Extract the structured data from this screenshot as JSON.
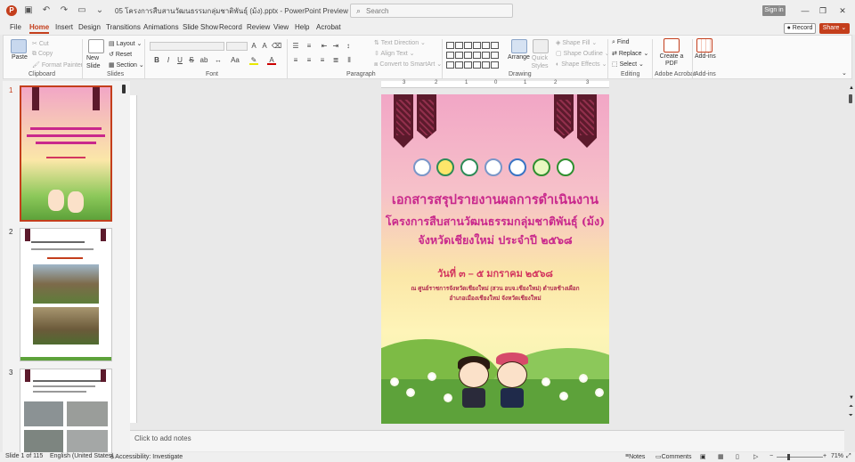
{
  "titlebar": {
    "app_icon": "powerpoint-logo",
    "document_title": "05 โครงการสืบสานวัฒนธรรมกลุ่มชาติพันธุ์ (ม้ง).pptx - PowerPoint Preview",
    "search_placeholder": "Search",
    "signin_label": "Sign in",
    "window_controls": [
      "minimize-icon",
      "restore-icon",
      "close-icon"
    ]
  },
  "menu_tabs": [
    "File",
    "Home",
    "Insert",
    "Design",
    "Transitions",
    "Animations",
    "Slide Show",
    "Record",
    "Review",
    "View",
    "Help",
    "Acrobat"
  ],
  "active_tab": "Home",
  "header_buttons": {
    "record": "Record",
    "share": "Share"
  },
  "ribbon": {
    "clipboard": {
      "label": "Clipboard",
      "paste": "Paste",
      "cut": "Cut",
      "copy": "Copy",
      "format_painter": "Format Painter"
    },
    "slides": {
      "label": "Slides",
      "new_slide": "New Slide",
      "layout": "Layout",
      "reset": "Reset",
      "section": "Section"
    },
    "font": {
      "label": "Font",
      "bold": "B",
      "italic": "I",
      "underline": "U",
      "strike": "S",
      "case": "Aa"
    },
    "paragraph": {
      "label": "Paragraph",
      "text_direction": "Text Direction",
      "align_text": "Align Text",
      "smartart": "Convert to SmartArt"
    },
    "drawing": {
      "label": "Drawing",
      "arrange": "Arrange",
      "quick_styles": "Quick Styles",
      "shape_fill": "Shape Fill",
      "shape_outline": "Shape Outline",
      "shape_effects": "Shape Effects"
    },
    "editing": {
      "label": "Editing",
      "find": "Find",
      "replace": "Replace",
      "select": "Select"
    },
    "acrobat": {
      "label": "Adobe Acrobat",
      "create_pdf": "Create a PDF"
    },
    "addins": {
      "label": "Add-ins",
      "addins_btn": "Add-ins"
    }
  },
  "thumbnails": [
    {
      "number": "1",
      "selected": true
    },
    {
      "number": "2",
      "selected": false
    },
    {
      "number": "3",
      "selected": false
    }
  ],
  "ruler": {
    "top_ticks": [
      "3",
      "2",
      "1",
      "0",
      "1",
      "2",
      "3"
    ]
  },
  "slide": {
    "title_line1": "เอกสารสรุปรายงานผลการดำเนินงาน",
    "title_line2": "โครงการสืบสานวัฒนธรรมกลุ่มชาติพันธุ์ (ม้ง)",
    "title_line3": "จังหวัดเชียงใหม่ ประจำปี ๒๕๖๘",
    "date": "วันที่ ๓ – ๕ มกราคม ๒๕๖๘",
    "venue_line1": "ณ ศูนย์ราชการจังหวัดเชียงใหม่ (สวน อบจ.เชียงใหม่) ตำบลช้างเผือก",
    "venue_line2": "อำเภอเมืองเชียงใหม่ จังหวัดเชียงใหม่"
  },
  "notes_placeholder": "Click to add notes",
  "status": {
    "slide_info": "Slide 1 of 115",
    "language": "English (United States)",
    "accessibility": "Accessibility: Investigate",
    "notes": "Notes",
    "comments": "Comments",
    "zoom": "71%"
  },
  "colors": {
    "accent": "#c43e1c",
    "slide_title": "#c9288c"
  }
}
